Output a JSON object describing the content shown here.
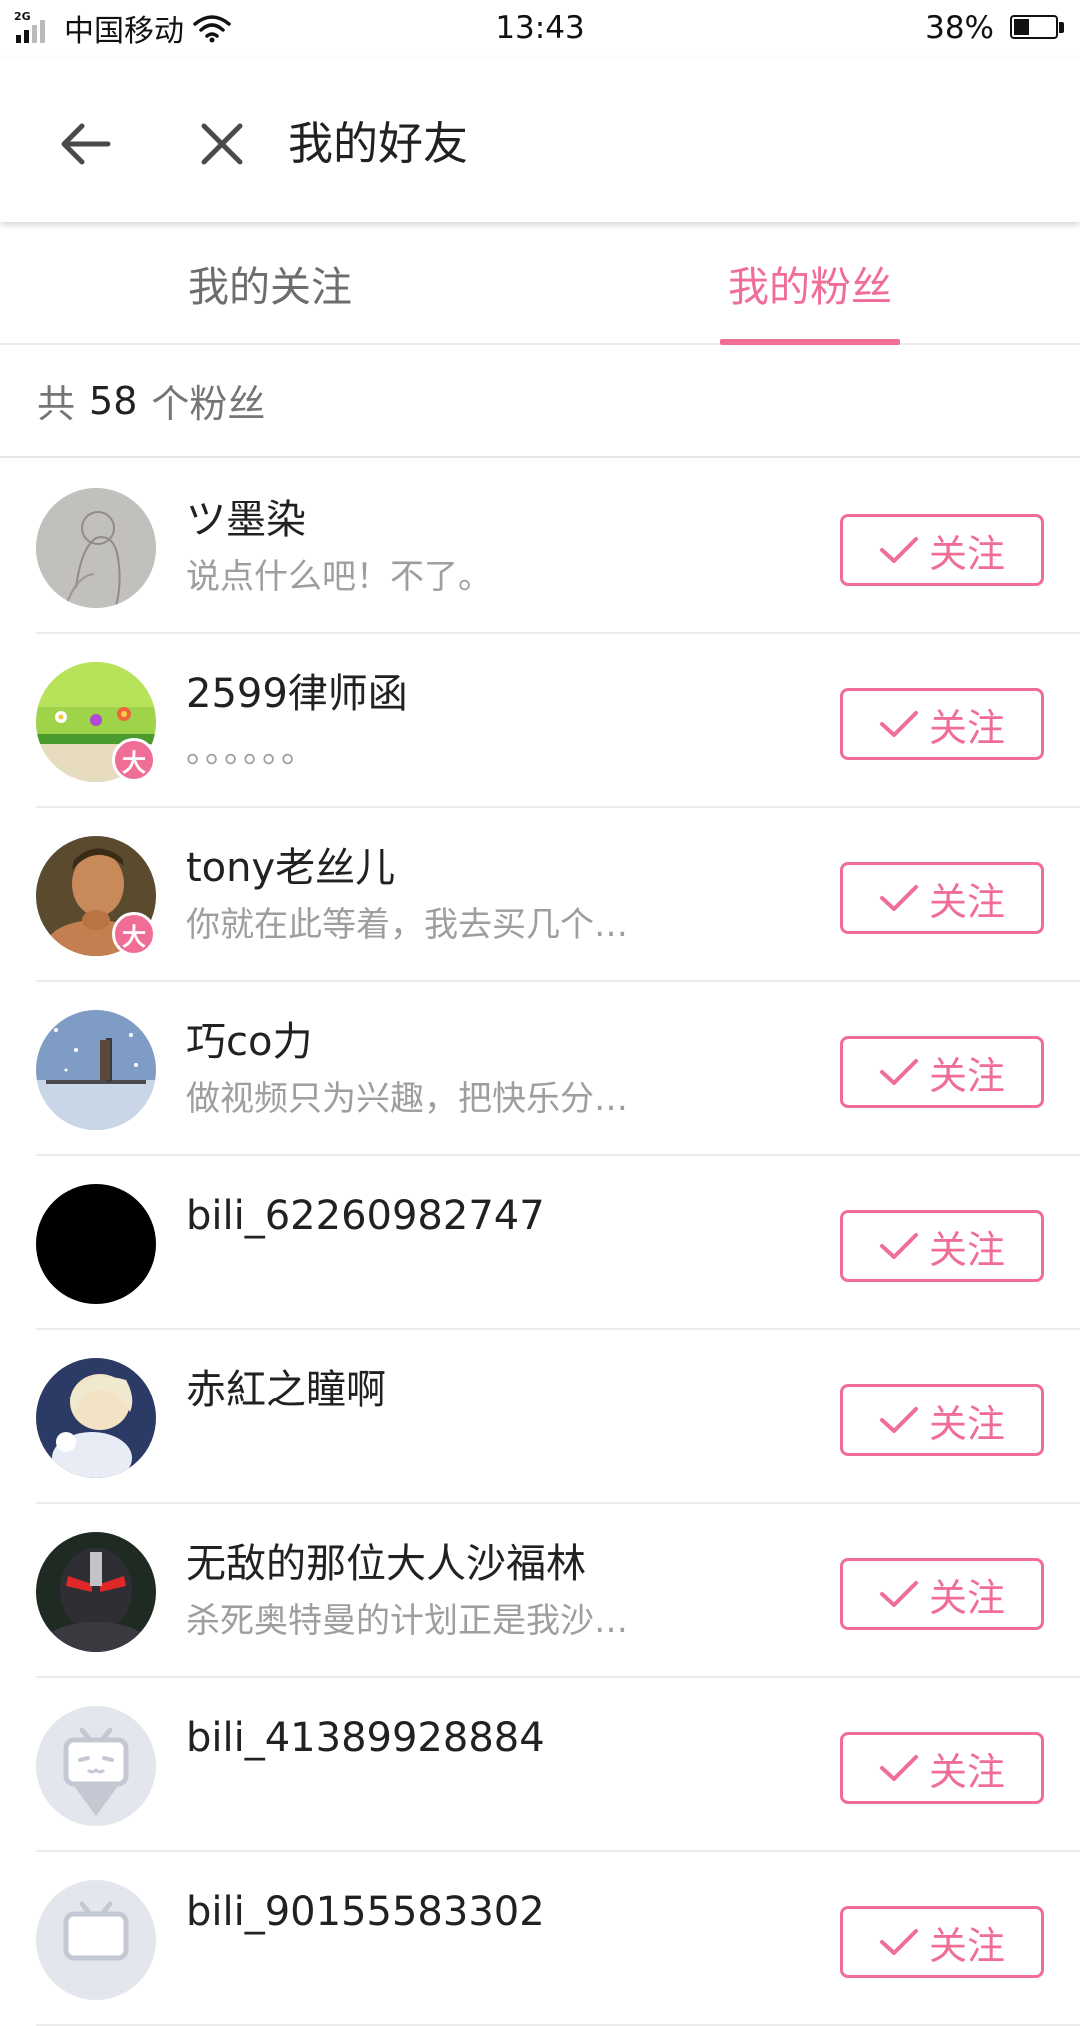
{
  "status_bar": {
    "network": "2G",
    "carrier": "中国移动",
    "time": "13:43",
    "battery": "38%",
    "battery_level": 0.38
  },
  "toolbar": {
    "title": "我的好友"
  },
  "tabs": [
    {
      "label": "我的关注",
      "active": false
    },
    {
      "label": "我的粉丝",
      "active": true
    }
  ],
  "fans_count": {
    "prefix": "共",
    "count": "58",
    "suffix": "个粉丝"
  },
  "follow_label": "关注",
  "accent_color": "#f06e96",
  "users": [
    {
      "name": "ツ墨染",
      "desc": "说点什么吧！不了。",
      "badge": ""
    },
    {
      "name": "2599律师函",
      "desc": "。。。。。。",
      "badge": "大"
    },
    {
      "name": "tony老丝儿",
      "desc": "你就在此等着，我去买几个…",
      "badge": "大"
    },
    {
      "name": "巧co力",
      "desc": "做视频只为兴趣，把快乐分…",
      "badge": ""
    },
    {
      "name": "bili_62260982747",
      "desc": "",
      "badge": ""
    },
    {
      "name": "赤紅之瞳啊",
      "desc": "",
      "badge": ""
    },
    {
      "name": "无敌的那位大人沙福林",
      "desc": "杀死奥特曼的计划正是我沙…",
      "badge": ""
    },
    {
      "name": "bili_41389928884",
      "desc": "",
      "badge": ""
    },
    {
      "name": "bili_90155583302",
      "desc": "",
      "badge": ""
    }
  ]
}
